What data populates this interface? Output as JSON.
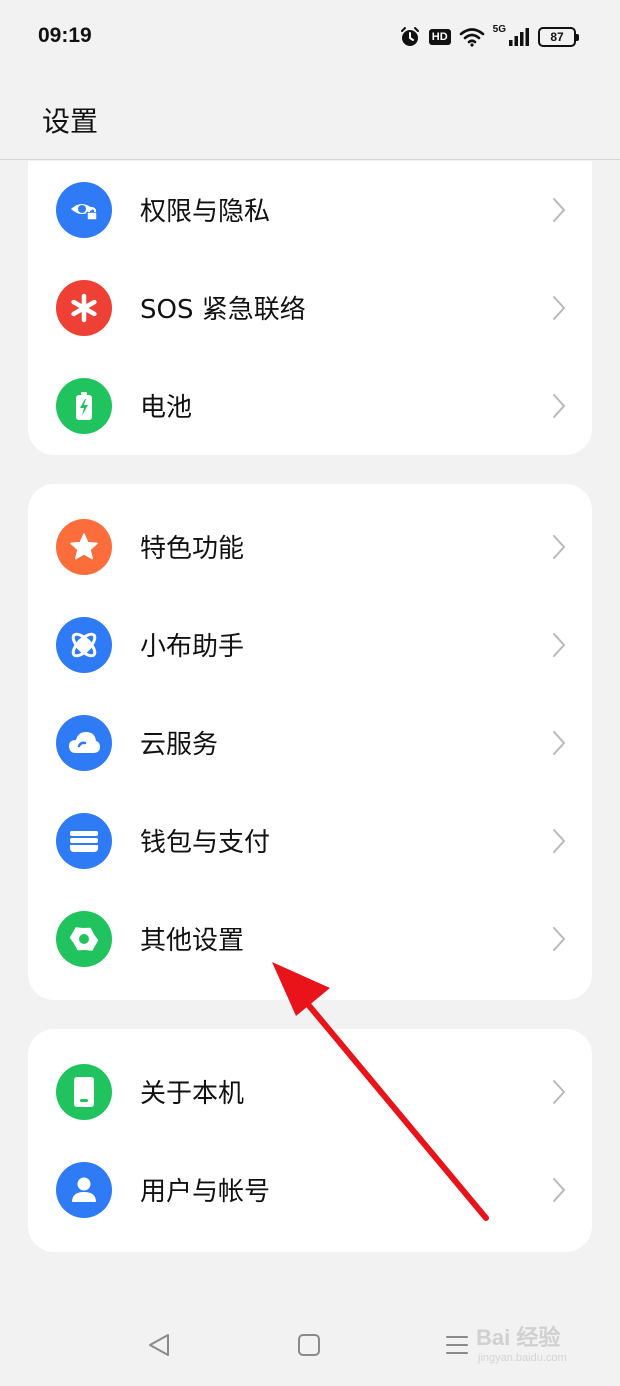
{
  "status_bar": {
    "time": "09:19",
    "hd_label": "HD",
    "network_label": "5G",
    "battery_level": "87",
    "icons": [
      "alarm-icon",
      "hd-icon",
      "wifi-icon",
      "signal-icon",
      "battery-icon"
    ]
  },
  "header": {
    "title": "设置"
  },
  "groups": [
    {
      "items": [
        {
          "label": "权限与隐私",
          "icon": "privacy-eye-lock-icon",
          "color": "#2f7bf6"
        },
        {
          "label": "SOS 紧急联络",
          "icon": "sos-asterisk-icon",
          "color": "#ee4035"
        },
        {
          "label": "电池",
          "icon": "battery-charge-icon",
          "color": "#21c35e"
        }
      ]
    },
    {
      "items": [
        {
          "label": "特色功能",
          "icon": "star-icon",
          "color": "#fb6e3b"
        },
        {
          "label": "小布助手",
          "icon": "assistant-orbit-icon",
          "color": "#2f7bf6"
        },
        {
          "label": "云服务",
          "icon": "cloud-icon",
          "color": "#2f7bf6"
        },
        {
          "label": "钱包与支付",
          "icon": "wallet-icon",
          "color": "#2f7bf6"
        },
        {
          "label": "其他设置",
          "icon": "gear-icon",
          "color": "#21c35e"
        }
      ]
    },
    {
      "items": [
        {
          "label": "关于本机",
          "icon": "phone-device-icon",
          "color": "#21c35e"
        },
        {
          "label": "用户与帐号",
          "icon": "user-icon",
          "color": "#2f7bf6"
        }
      ]
    }
  ],
  "nav_bar": {
    "buttons": [
      "back-triangle-icon",
      "home-square-icon",
      "recents-menu-icon"
    ]
  },
  "watermark": {
    "main": "Bai 经验",
    "sub": "jingyan.baidu.com"
  },
  "annotation": {
    "arrow_color": "#e8141a"
  }
}
